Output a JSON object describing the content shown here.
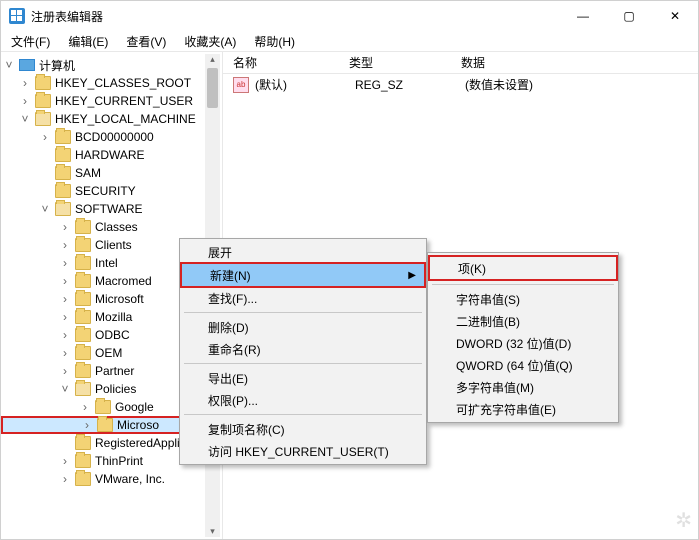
{
  "window": {
    "title": "注册表编辑器"
  },
  "menu": {
    "file": "文件(F)",
    "edit": "编辑(E)",
    "view": "查看(V)",
    "fav": "收藏夹(A)",
    "help": "帮助(H)"
  },
  "tree": {
    "root": "计算机",
    "hives": [
      "HKEY_CLASSES_ROOT",
      "HKEY_CURRENT_USER",
      "HKEY_LOCAL_MACHINE"
    ],
    "hklm": [
      "BCD00000000",
      "HARDWARE",
      "SAM",
      "SECURITY",
      "SOFTWARE"
    ],
    "software": [
      "Classes",
      "Clients",
      "Intel",
      "Macromed",
      "Microsoft",
      "Mozilla",
      "ODBC",
      "OEM",
      "Partner",
      "Policies",
      "RegisteredApplica",
      "ThinPrint",
      "VMware, Inc."
    ],
    "policies": [
      "Google",
      "Microso"
    ]
  },
  "listHeader": {
    "name": "名称",
    "type": "类型",
    "data": "数据"
  },
  "listRow": {
    "name": "(默认)",
    "type": "REG_SZ",
    "data": "(数值未设置)",
    "iconText": "ab"
  },
  "ctx1": {
    "expand": "展开",
    "new": "新建(N)",
    "find": "查找(F)...",
    "del": "删除(D)",
    "ren": "重命名(R)",
    "export": "导出(E)",
    "perm": "权限(P)...",
    "copy": "复制项名称(C)",
    "jump": "访问 HKEY_CURRENT_USER(T)"
  },
  "ctx2": {
    "key": "项(K)",
    "str": "字符串值(S)",
    "bin": "二进制值(B)",
    "dword": "DWORD (32 位)值(D)",
    "qword": "QWORD (64 位)值(Q)",
    "multi": "多字符串值(M)",
    "expand": "可扩充字符串值(E)"
  }
}
